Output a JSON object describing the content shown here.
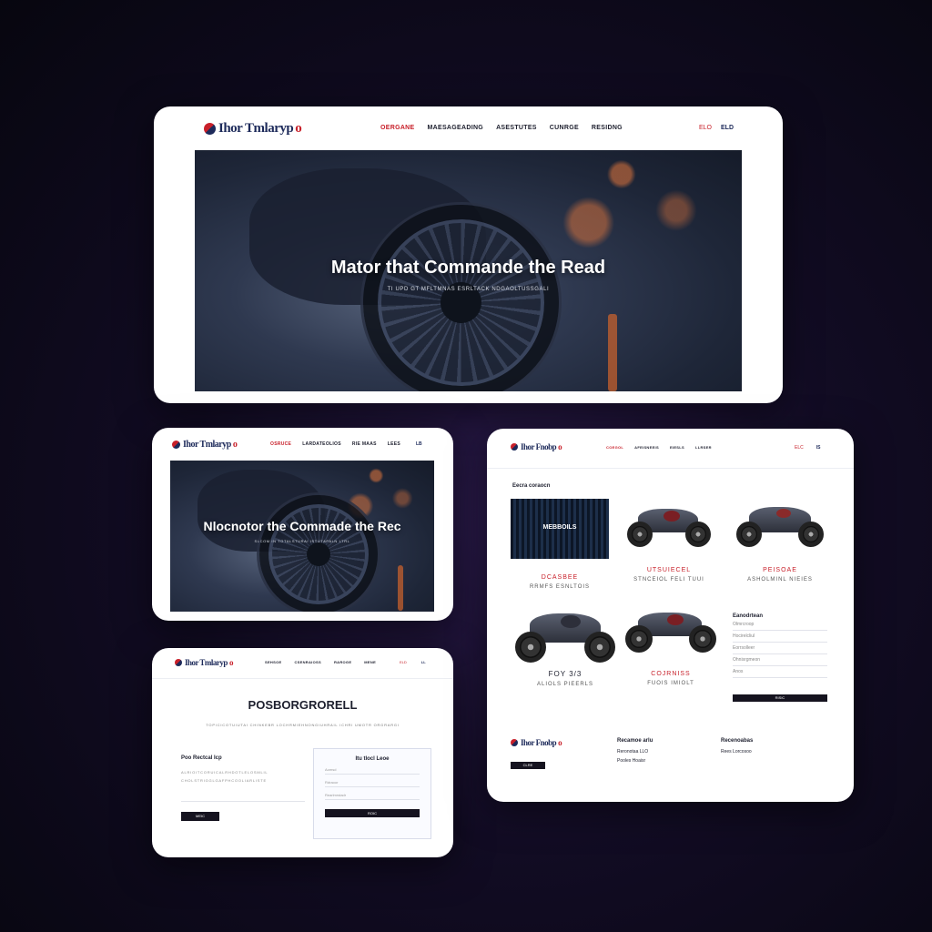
{
  "brand": {
    "name": "Ihor Tmlaryp",
    "tail": "o",
    "color_primary": "#1d2a5a",
    "color_accent": "#c8202a"
  },
  "screen1": {
    "nav": [
      "OERGANE",
      "MAESAGEADING",
      "ASESTUTES",
      "CUNRGE",
      "RESIDNG"
    ],
    "lang": "ELO",
    "user": "ELD",
    "hero_title": "Mator that Commande the Read",
    "hero_sub": "TI UPD GT MFLTMNAS ESRLTACK NDGAOLTUSSGALI"
  },
  "screen2": {
    "logo": "Ihor Tmlaryp",
    "nav": [
      "OSRUCE",
      "LARDATEOLIOS",
      "RIE MAAS",
      "LEES"
    ],
    "user": "LB",
    "hero_title": "Nlocnotor the Commade the Rec",
    "hero_sub": "SLCOM IN TGTALSTURAI ISTUTAPALN LTRL"
  },
  "screen3": {
    "logo": "Ihor Tmlaryp",
    "nav": [
      "SEHSOE",
      "CSENRAIOSS",
      "RAROGE",
      "MENE"
    ],
    "lang": "ELD",
    "user": "LL",
    "title": "POSBORGRORELL",
    "desc": "TOPICICOTUIUTAI CHINKEBR LOCHRMIEHNONGIUHRAIL ICHRI UMOTR ORGRARGI",
    "left_heading": "Poo Rectcal Icp",
    "left_lines": [
      "ALRIOITCORUICALRHDOTLELOSMLIL",
      "CHOLSTRIGGLGAFPHCOOLIARLISTE"
    ],
    "left_button": "MEIC",
    "form_title": "Itu tlocl Leoe",
    "form_fields": [
      "Aomsd",
      "Rdraoor",
      "Rearlmrstadr"
    ],
    "form_button": "ROIC"
  },
  "screen4": {
    "logo": "Ihor Fnobp",
    "nav": [
      "COEGOL",
      "AFEISNEEIS",
      "EIESLS",
      "LLRSER"
    ],
    "lang": "ELC",
    "user": "IS",
    "section_title": "Eecra coraocn",
    "feature_overlay": "MEBBOILS",
    "products": [
      {
        "name": "DCASBEE",
        "meta": "RRMFS ESNLTOIS"
      },
      {
        "name": "UTSUIECEL",
        "meta": "STNCEIOL FELI TUUI"
      },
      {
        "name": "PEISOAE",
        "meta": "ASHOLMINL NIEIES"
      },
      {
        "name": "FOY 3/3",
        "meta": "ALIOLS PIEERLS"
      },
      {
        "name": "COJRNISS",
        "meta": "FUOIS IMIOLT"
      }
    ],
    "filter_title": "Eanodrtean",
    "filter_rows": [
      "Olmrcroop",
      "Hocirelcliul",
      "Eorrsolleer",
      "Ohnisrgmeon",
      "Anos"
    ],
    "filter_button": "RISIC",
    "footer_logo": "Ihor Fnobp",
    "footer_button": "CLRE",
    "footer_col1_title": "Recamoe arlu",
    "footer_col1_lines": [
      "Reronotaa LLO",
      "Pooles Hoaisr"
    ],
    "footer_col2_title": "Recenoabas",
    "footer_col2_lines": [
      "Rees Lorcosoo"
    ]
  }
}
